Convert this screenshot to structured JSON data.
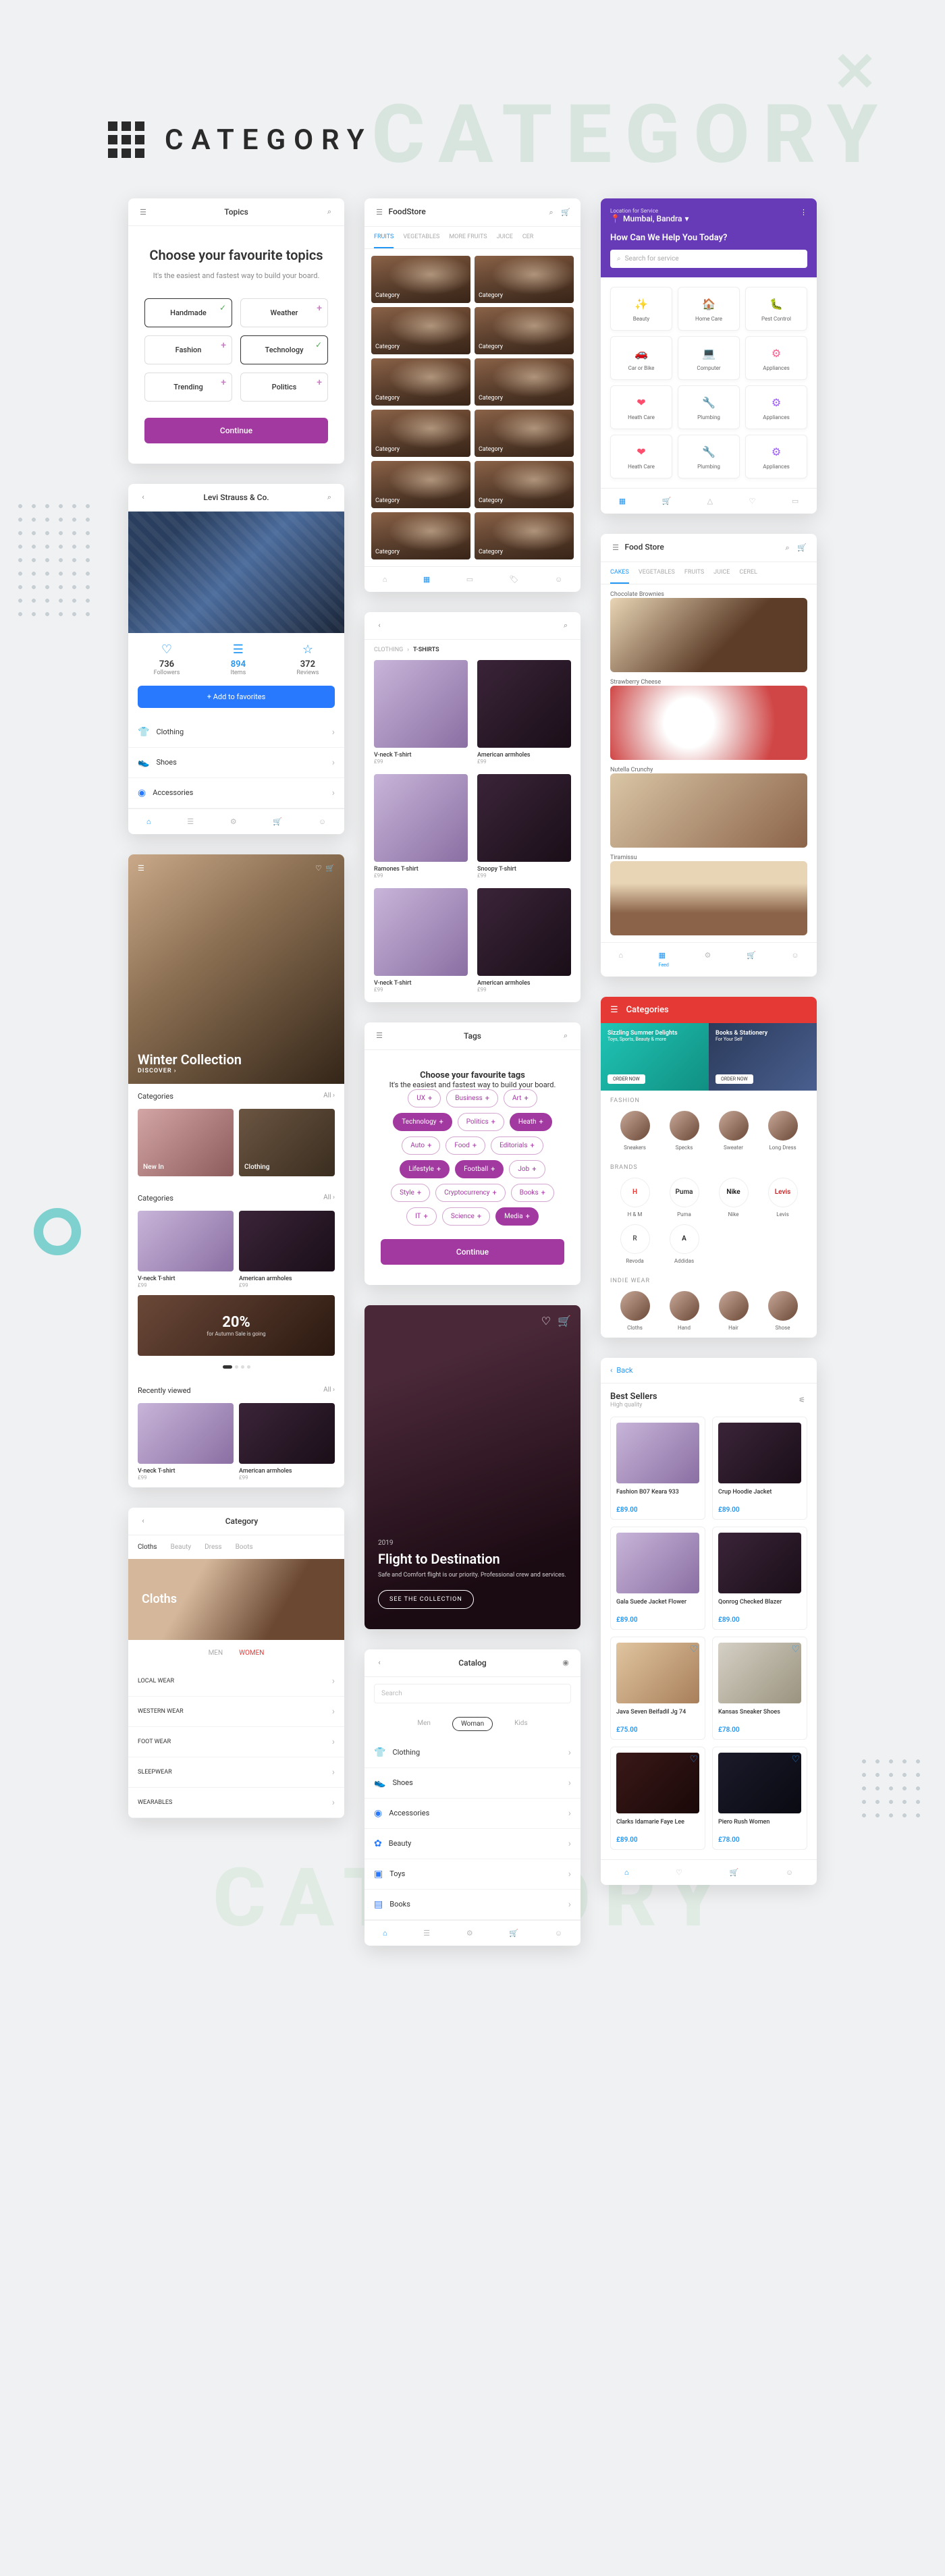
{
  "header_title": "CATEGORY",
  "bg_text": "CATEGORY",
  "s1": {
    "title": "Topics",
    "heading": "Choose your favourite topics",
    "sub": "It's the easiest and fastest way to build your board.",
    "topics": [
      {
        "label": "Handmade",
        "selected": true
      },
      {
        "label": "Weather",
        "selected": false
      },
      {
        "label": "Fashion",
        "selected": false
      },
      {
        "label": "Technology",
        "selected": true
      },
      {
        "label": "Trending",
        "selected": false
      },
      {
        "label": "Politics",
        "selected": false
      }
    ],
    "cta": "Continue"
  },
  "s2": {
    "title": "FoodStore",
    "tabs": [
      "FRUITS",
      "VEGETABLES",
      "MORE FRUITS",
      "JUICE",
      "CER"
    ],
    "item_label": "Category"
  },
  "s3": {
    "loc_label": "Location for Service",
    "location": "Mumbai, Bandra",
    "help": "How Can We Help You Today?",
    "search_placeholder": "Search for service",
    "services": [
      {
        "label": "Beauty",
        "icon": "✨",
        "color": "#ff6f9c"
      },
      {
        "label": "Home Care",
        "icon": "🏠",
        "color": "#7b5dff"
      },
      {
        "label": "Pest Control",
        "icon": "🐛",
        "color": "#ff8a3d"
      },
      {
        "label": "Car or Bike",
        "icon": "🚗",
        "color": "#4db5ff"
      },
      {
        "label": "Computer",
        "icon": "💻",
        "color": "#5d8fff"
      },
      {
        "label": "Appliances",
        "icon": "⚙",
        "color": "#ff5d8f"
      },
      {
        "label": "Heath Care",
        "icon": "❤",
        "color": "#ff4d6d"
      },
      {
        "label": "Plumbing",
        "icon": "🔧",
        "color": "#4dcfcf"
      },
      {
        "label": "Appliances",
        "icon": "⚙",
        "color": "#9f5dff"
      },
      {
        "label": "Heath Care",
        "icon": "❤",
        "color": "#ff4d6d"
      },
      {
        "label": "Plumbing",
        "icon": "🔧",
        "color": "#4dcfcf"
      },
      {
        "label": "Appliances",
        "icon": "⚙",
        "color": "#9f5dff"
      }
    ]
  },
  "s4": {
    "title": "Levi Strauss & Co.",
    "stats": [
      {
        "num": "736",
        "label": "Followers",
        "icon": "♡"
      },
      {
        "num": "894",
        "label": "Items",
        "icon": "☰",
        "active": true
      },
      {
        "num": "372",
        "label": "Reviews",
        "icon": "☆"
      }
    ],
    "fav_btn": "+   Add to favorites",
    "list": [
      {
        "label": "Clothing",
        "icon": "👕"
      },
      {
        "label": "Shoes",
        "icon": "👟"
      },
      {
        "label": "Accessories",
        "icon": "◉"
      }
    ]
  },
  "s5": {
    "hero_title": "Winter Collection",
    "discover": "DISCOVER ›",
    "section_cat": "Categories",
    "all": "All ›",
    "tiles": [
      "New In",
      "Clothing"
    ],
    "products": [
      {
        "name": "V-neck T-shirt",
        "price": "£99"
      },
      {
        "name": "American armholes",
        "price": "£99"
      }
    ],
    "promo_pct": "20%",
    "promo_sub": "for Autumn Sale is going",
    "recently": "Recently viewed"
  },
  "s6": {
    "title": "Category",
    "tabs": [
      "Cloths",
      "Beauty",
      "Dress",
      "Boots"
    ],
    "banner": "Cloths",
    "subtabs": [
      "MEN",
      "WOMEN"
    ],
    "list": [
      "LOCAL WEAR",
      "WESTERN WEAR",
      "FOOT WEAR",
      "SLEEPWEAR",
      "WEARABLES"
    ]
  },
  "s7": {
    "crumb_parent": "CLOTHING",
    "crumb_current": "T-SHIRTS",
    "products": [
      {
        "name": "V-neck T-shirt",
        "price": "£99"
      },
      {
        "name": "American armholes",
        "price": "£99"
      },
      {
        "name": "Ramones T-shirt",
        "price": "£99"
      },
      {
        "name": "Snoopy T-shirt",
        "price": "£99"
      },
      {
        "name": "V-neck T-shirt",
        "price": "£99"
      },
      {
        "name": "American armholes",
        "price": "£99"
      }
    ]
  },
  "s8": {
    "title": "Tags",
    "heading": "Choose your favourite tags",
    "sub": "It's the easiest and fastest way to build your board.",
    "tags": [
      {
        "t": "UX"
      },
      {
        "t": "Business"
      },
      {
        "t": "Art"
      },
      {
        "t": "Technology",
        "sel": true
      },
      {
        "t": "Politics"
      },
      {
        "t": "Heath",
        "sel": true
      },
      {
        "t": "Auto"
      },
      {
        "t": "Food"
      },
      {
        "t": "Editorials"
      },
      {
        "t": "Lifestyle",
        "sel": true
      },
      {
        "t": "Football",
        "sel": true
      },
      {
        "t": "Job"
      },
      {
        "t": "Style"
      },
      {
        "t": "Cryptocurrency"
      },
      {
        "t": "Books"
      },
      {
        "t": "IT"
      },
      {
        "t": "Science"
      },
      {
        "t": "Media",
        "sel": true
      }
    ],
    "cta": "Continue"
  },
  "s9": {
    "year": "2019",
    "title": "Flight to Destination",
    "desc": "Safe and Comfort flight is our priority. Professional crew and services.",
    "cta": "SEE THE COLLECTION"
  },
  "s10": {
    "title": "Catalog",
    "search": "Search",
    "gender": [
      "Men",
      "Woman",
      "Kids"
    ],
    "list": [
      {
        "label": "Clothing",
        "icon": "👕"
      },
      {
        "label": "Shoes",
        "icon": "👟"
      },
      {
        "label": "Accessories",
        "icon": "◉"
      },
      {
        "label": "Beauty",
        "icon": "✿"
      },
      {
        "label": "Toys",
        "icon": "▣"
      },
      {
        "label": "Books",
        "icon": "▤"
      }
    ]
  },
  "s11": {
    "title": "Food Store",
    "tabs": [
      "CAKES",
      "VEGETABLES",
      "FRUITS",
      "JUICE",
      "CEREL"
    ],
    "items": [
      "Chocolate Brownies",
      "Strawberry Cheese",
      "Nutella Crunchy",
      "Tiramissu"
    ]
  },
  "s12": {
    "title": "Categories",
    "promo1": {
      "title": "Sizzling Summer Delights",
      "sub": "Toys, Sports, Beauty & more",
      "btn": "ORDER NOW"
    },
    "promo2": {
      "title": "Books & Stationery",
      "sub": "For Your Self",
      "btn": "ORDER NOW"
    },
    "sections": [
      {
        "title": "FASHION",
        "items": [
          "Sneakers",
          "Specks",
          "Sweater",
          "Long Dress"
        ]
      },
      {
        "title": "BRANDS",
        "items": [
          "H & M",
          "Puma",
          "Nike",
          "Levis"
        ],
        "items2": [
          "Revoda",
          "Addidas"
        ]
      },
      {
        "title": "INDIE WEAR",
        "items": [
          "Cloths",
          "Hand",
          "Hair",
          "Shose"
        ]
      }
    ]
  },
  "s13": {
    "back": "Back",
    "title": "Best Sellers",
    "sub": "High quality",
    "items": [
      {
        "name": "Fashion B07 Keara 933",
        "price": "£89.00",
        "img": "prod-img"
      },
      {
        "name": "Crup Hoodie Jacket",
        "price": "£89.00",
        "img": "prod-img v2"
      },
      {
        "name": "Gala Suede Jacket Flower",
        "price": "£89.00",
        "img": "prod-img"
      },
      {
        "name": "Qonrog Checked Blazer",
        "price": "£89.00",
        "img": "prod-img v2"
      },
      {
        "name": "Java Seven Beifadil Jg 74",
        "price": "£75.00",
        "img": "shoe1"
      },
      {
        "name": "Kansas Sneaker Shoes",
        "price": "£78.00",
        "img": "shoe2"
      },
      {
        "name": "Clarks Idamarie Faye Lee",
        "price": "£89.00",
        "img": "shoe3"
      },
      {
        "name": "Piero Rush Women",
        "price": "£78.00",
        "img": "shoe4"
      }
    ]
  }
}
